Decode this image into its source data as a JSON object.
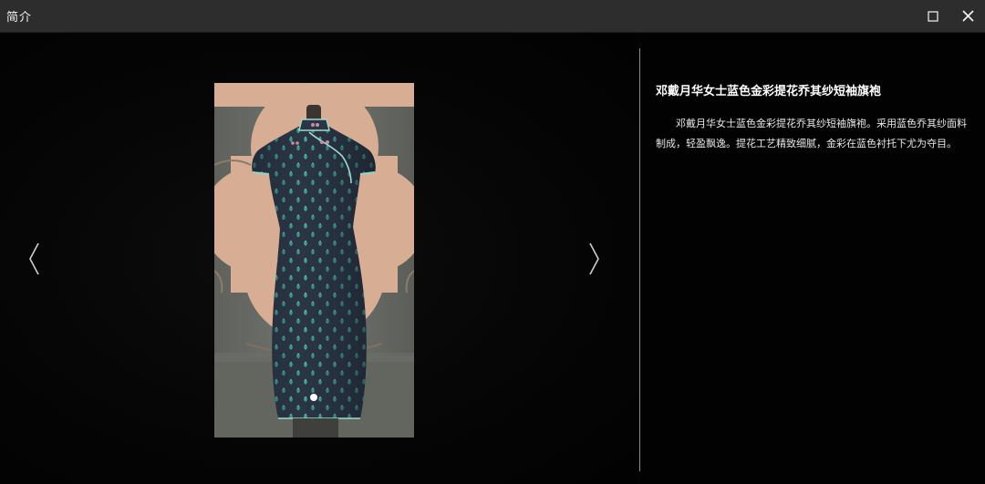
{
  "window": {
    "title": "简介"
  },
  "viewer": {
    "prev_arrow_icon": "chevron-left-icon",
    "next_arrow_icon": "chevron-right-icon",
    "slide_count": 1,
    "current_slide": 1
  },
  "info": {
    "heading": "邓戴月华女士蓝色金彩提花乔其纱短袖旗袍",
    "description": "邓戴月华女士蓝色金彩提花乔其纱短袖旗袍。采用蓝色乔其纱面料制成，轻盈飘逸。提花工艺精致细腻，金彩在蓝色衬托下尤为夺目。"
  },
  "colors": {
    "titlebar": "#2d2d2d",
    "background": "#040404",
    "text": "#ffffff",
    "dress_navy": "#2b3645",
    "pattern_teal": "#3fb5a6",
    "wall_peach": "#d7ad93"
  }
}
